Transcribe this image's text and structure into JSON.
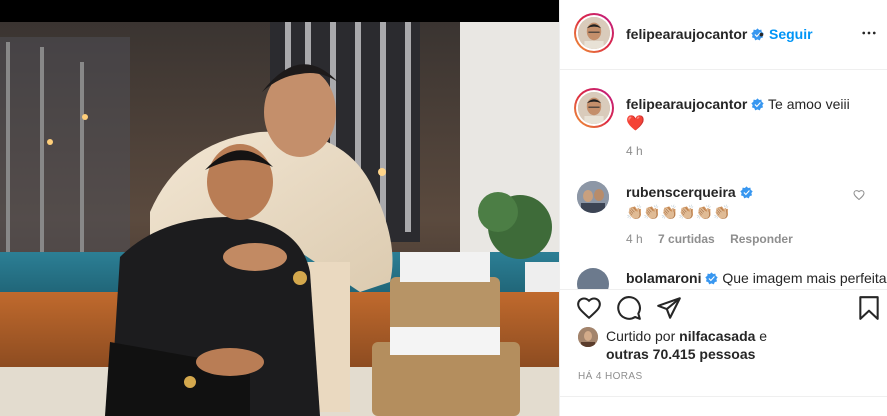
{
  "header": {
    "username": "felipearaujocantor",
    "separator": "•",
    "follow_label": "Seguir",
    "more_icon": "more-horizontal-icon"
  },
  "caption": {
    "username": "felipearaujocantor",
    "text": "Te amoo veiii",
    "emoji": "❤️",
    "time": "4 h"
  },
  "comments": [
    {
      "username": "rubenscerqueira",
      "text": "👏🏼👏🏼👏🏼👏🏼👏🏼👏🏼",
      "time": "4 h",
      "likes": "7 curtidas",
      "reply_label": "Responder"
    },
    {
      "username": "bolamaroni",
      "text": "Que imagem mais perfeita"
    }
  ],
  "actions": {
    "like_icon": "heart-outline-icon",
    "comment_icon": "comment-icon",
    "share_icon": "paper-plane-icon",
    "save_icon": "bookmark-icon"
  },
  "likes": {
    "prefix": "Curtido por ",
    "user": "nilfacasada",
    "middle": " e",
    "others": "outras 70.415 pessoas"
  },
  "post_date": "HÁ 4 HORAS",
  "colors": {
    "link_blue": "#0095f6",
    "verified_blue": "#3897f0",
    "muted_text": "#8e8e8e",
    "heart_red": "#e0245e",
    "border": "#efefef"
  }
}
